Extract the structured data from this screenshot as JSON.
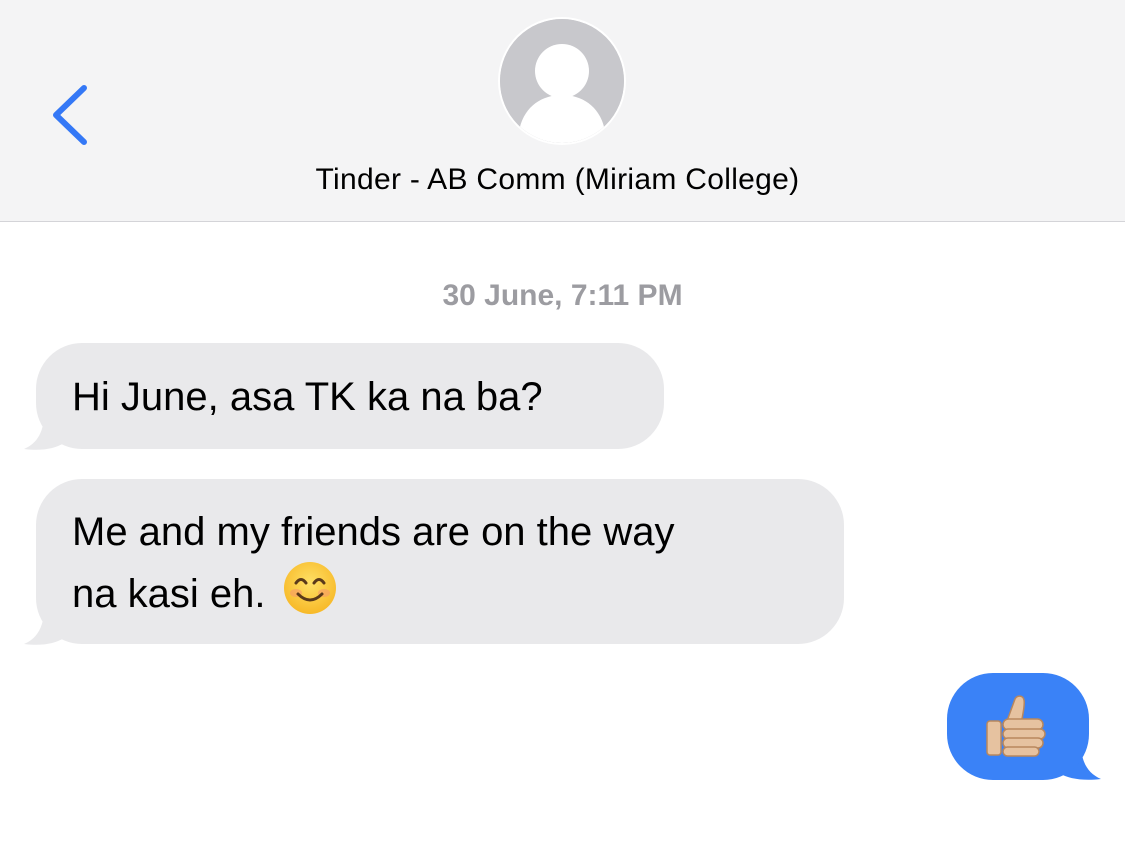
{
  "header": {
    "back_icon": "chevron-left-icon",
    "avatar_icon": "person-silhouette-icon",
    "contact_name": "Tinder - AB Comm (Miriam College)",
    "accent_color": "#3478f6"
  },
  "conversation": {
    "timestamp": "30 June, 7:11 PM",
    "messages": [
      {
        "direction": "received",
        "text": "Hi June, asa TK ka na ba?"
      },
      {
        "direction": "received",
        "line1": "Me and my friends are on the way",
        "line2": "na kasi eh.",
        "emoji": "smiling-face-icon"
      },
      {
        "direction": "sent",
        "emoji": "thumbs-up-icon"
      }
    ],
    "received_bubble_color": "#e9e9eb",
    "sent_bubble_color": "#3a82f7"
  }
}
